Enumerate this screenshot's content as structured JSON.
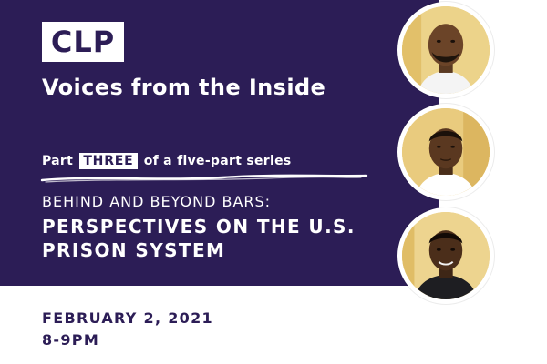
{
  "logo": {
    "text": "CLP"
  },
  "event": {
    "title": "Voices from the Inside",
    "series_prefix": "Part",
    "series_number": "THREE",
    "series_suffix": "of a five-part series",
    "kicker": "BEHIND AND BEYOND BARS:",
    "headline_line1": "PERSPECTIVES ON THE U.S.",
    "headline_line2": "PRISON SYSTEM",
    "date": "FEBRUARY 2, 2021",
    "time": "8-9PM"
  },
  "colors": {
    "panel": "#2c1d56",
    "text_light": "#ffffff",
    "text_dark": "#2c1d56",
    "photo_background": "#e8c978"
  },
  "avatars": [
    {
      "icon": "speaker-photo-1"
    },
    {
      "icon": "speaker-photo-2"
    },
    {
      "icon": "speaker-photo-3"
    }
  ]
}
